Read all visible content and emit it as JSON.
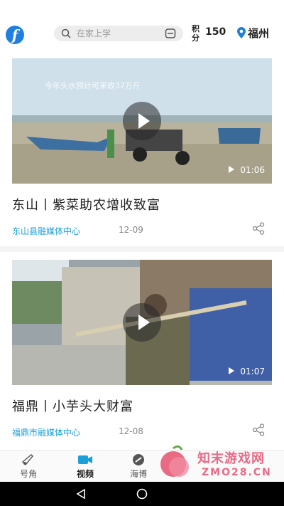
{
  "header": {
    "logo_letter": "f",
    "search_placeholder": "在家上学",
    "points_label": "积分",
    "points_value": "150",
    "city": "福州"
  },
  "feed": [
    {
      "overlay_text": "今年头水预计可采收37万斤",
      "duration": "01:06",
      "title": "东山丨紫菜助农增收致富",
      "source": "东山县融媒体中心",
      "date": "12-09"
    },
    {
      "duration": "01:07",
      "title": "福鼎丨小芋头大财富",
      "source": "福鼎市融媒体中心",
      "date": "12-08"
    }
  ],
  "tabbar": {
    "tabs": [
      {
        "label": "号角",
        "icon": "horn-icon"
      },
      {
        "label": "视频",
        "icon": "video-icon",
        "active": true
      },
      {
        "label": "海博",
        "icon": "haibo-icon"
      }
    ]
  },
  "watermark": {
    "line1": "知末游戏网",
    "line2": "ZMO28.CN"
  },
  "colors": {
    "accent": "#1a9fd8",
    "logo": "#1f7fe0",
    "video_tab": "#1a9fd8"
  }
}
